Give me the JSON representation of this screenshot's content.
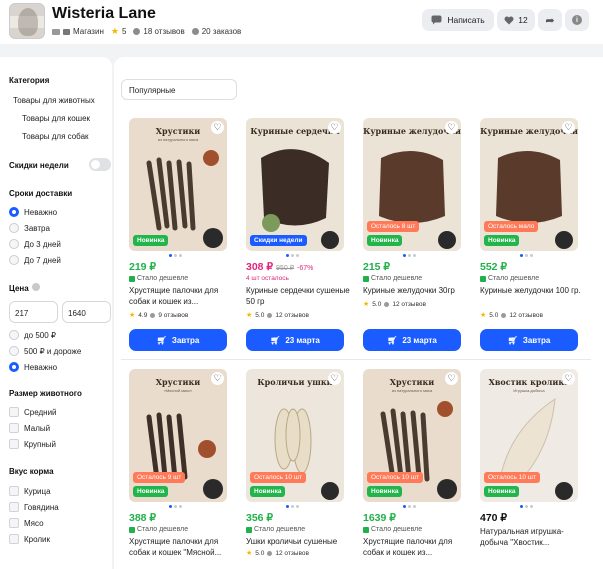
{
  "header": {
    "shop_name": "Wisteria Lane",
    "store_label": "Магазин",
    "rating": "5",
    "reviews": "18 отзывов",
    "orders": "20 заказов",
    "write_label": "Написать",
    "fav_count": "12"
  },
  "sidebar": {
    "category_title": "Категория",
    "cat_items": [
      "Товары для животных",
      "Товары для кошек",
      "Товары для собак"
    ],
    "week_discounts": "Скидки недели",
    "delivery_title": "Сроки доставки",
    "delivery_opts": [
      "Неважно",
      "Завтра",
      "До 3 дней",
      "До 7 дней"
    ],
    "price_title": "Цена",
    "price_from": "217",
    "price_to": "1640",
    "price_opts": [
      "до 500 ₽",
      "500 ₽ и дороже",
      "Неважно"
    ],
    "size_title": "Размер животного",
    "size_opts": [
      "Средний",
      "Малый",
      "Крупный"
    ],
    "taste_title": "Вкус корма",
    "taste_opts": [
      "Курица",
      "Говядина",
      "Мясо",
      "Кролик"
    ]
  },
  "sort": {
    "selected": "Популярные"
  },
  "colors": {
    "accent": "#1a5cff",
    "price_green": "#20b14a",
    "discount_pink": "#e0257b",
    "badge_new": "#22b54b",
    "badge_left": "#ff7a59"
  },
  "products": [
    {
      "img_title": "Хрустики",
      "img_sub": "из натурального мяса",
      "badge_left": "",
      "badge": "Новинка",
      "price": "219 ₽",
      "old_price": "",
      "discount": "",
      "note": "Стало дешевле",
      "name": "Хрустящие палочки для собак и кошек из...",
      "rating": "4.9",
      "reviews": "9 отзывов",
      "delivery": "Завтра"
    },
    {
      "img_title": "Куриные сердечки",
      "img_sub": "",
      "badge_left": "",
      "badge": "Скидки недели",
      "price": "308 ₽",
      "old_price": "950 ₽",
      "discount": "-67%",
      "note": "4 шт осталось",
      "name": "Куриные сердечки сушеные 50 гр",
      "rating": "5.0",
      "reviews": "12 отзывов",
      "delivery": "23 марта"
    },
    {
      "img_title": "Куриные желудочки",
      "img_sub": "",
      "badge_left": "Осталось 8 шт",
      "badge": "Новинка",
      "price": "215 ₽",
      "old_price": "",
      "discount": "",
      "note": "Стало дешевле",
      "name": "Куриные желудочки 30гр",
      "rating": "5.0",
      "reviews": "12 отзывов",
      "delivery": "23 марта"
    },
    {
      "img_title": "Куриные желудочки",
      "img_sub": "",
      "badge_left": "Осталось мало",
      "badge": "Новинка",
      "price": "552 ₽",
      "old_price": "",
      "discount": "",
      "note": "Стало дешевле",
      "name": "Куриные желудочки 100 гр.",
      "rating": "5.0",
      "reviews": "12 отзывов",
      "delivery": "Завтра"
    },
    {
      "img_title": "Хрустики",
      "img_sub": "«Мясной микс»",
      "badge_left": "Осталось 9 шт",
      "badge": "Новинка",
      "price": "388 ₽",
      "old_price": "",
      "discount": "",
      "note": "Стало дешевле",
      "name": "Хрустящие палочки для собак и кошек \"Мясной..."
    },
    {
      "img_title": "Кроличьи ушки",
      "img_sub": "",
      "badge_left": "Осталось 10 шт",
      "badge": "Новинка",
      "price": "356 ₽",
      "old_price": "",
      "discount": "",
      "note": "Стало дешевле",
      "name": "Ушки кроличьи сушеные",
      "rating": "5.0",
      "reviews": "12 отзывов"
    },
    {
      "img_title": "Хрустики",
      "img_sub": "из натурального мяса",
      "badge_left": "Осталось 10 шт",
      "badge": "Новинка",
      "price": "1639 ₽",
      "old_price": "",
      "discount": "",
      "note": "Стало дешевле",
      "name": "Хрустящие палочки для собак и кошек из..."
    },
    {
      "img_title": "Хвостик кролика",
      "img_sub": "Игрушка-добыча",
      "badge_left": "Осталось 10 шт",
      "badge": "Новинка",
      "price": "470 ₽",
      "old_price": "",
      "discount": "",
      "note": "",
      "name": "Натуральная игрушка-добыча \"Хвостик..."
    }
  ]
}
